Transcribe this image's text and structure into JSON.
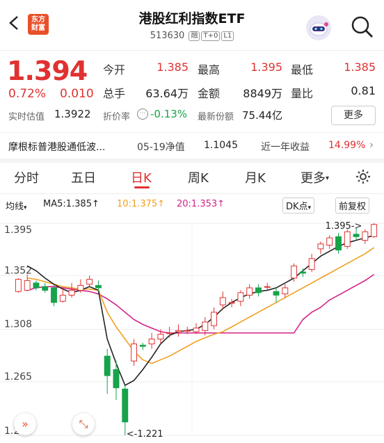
{
  "header": {
    "title": "港股红利指数ETF",
    "code": "513630",
    "tags": [
      "融",
      "T+0",
      "L1"
    ],
    "logo": "东方财富"
  },
  "quote": {
    "price": "1.394",
    "change_pct": "0.72%",
    "change": "0.010",
    "open_label": "今开",
    "open": "1.385",
    "high_label": "最高",
    "high": "1.395",
    "low_label": "最低",
    "low": "1.385",
    "vol_label": "总手",
    "vol": "63.64万",
    "amount_label": "金额",
    "amount": "8849万",
    "ratio_label": "量比",
    "ratio": "0.81",
    "iopv_label": "实时估值",
    "iopv": "1.3922",
    "premium_label": "折价率",
    "premium": "-0.13%",
    "shares_label": "最新份额",
    "shares": "75.44亿",
    "more": "更多"
  },
  "info": {
    "index_name": "摩根标普港股通低波...",
    "nav_date": "05-19净值",
    "nav": "1.1045",
    "year_label": "近一年收益",
    "year_ret": "14.99%"
  },
  "tabs": [
    "分时",
    "五日",
    "日K",
    "周K",
    "月K",
    "更多"
  ],
  "toolbar": {
    "ma_btn": "均线",
    "ma5": "MA5:1.385",
    "ma10": "10:1.375",
    "ma20": "20:1.353",
    "dk": "DK点",
    "adjust": "前复权"
  },
  "colors": {
    "up": "#e03131",
    "down": "#17a34a",
    "ma5": "#222222",
    "ma10": "#f0a020",
    "ma20": "#d2238a"
  },
  "chart_data": {
    "type": "candlestick",
    "ylim": [
      1.221,
      1.395
    ],
    "y_ticks": [
      "1.395",
      "1.352",
      "1.308",
      "1.265",
      "1.221"
    ],
    "max_label": "1.395->",
    "min_label": "<-1.221",
    "candles": [
      [
        1.339,
        1.349,
        1.35,
        1.338
      ],
      [
        1.34,
        1.348,
        1.353,
        1.339
      ],
      [
        1.346,
        1.342,
        1.348,
        1.34
      ],
      [
        1.343,
        1.34,
        1.346,
        1.338
      ],
      [
        1.342,
        1.33,
        1.345,
        1.327
      ],
      [
        1.331,
        1.336,
        1.342,
        1.33
      ],
      [
        1.336,
        1.34,
        1.346,
        1.334
      ],
      [
        1.34,
        1.344,
        1.349,
        1.338
      ],
      [
        1.345,
        1.349,
        1.352,
        1.343
      ],
      [
        1.344,
        1.342,
        1.348,
        1.339
      ],
      [
        1.286,
        1.27,
        1.292,
        1.255
      ],
      [
        1.275,
        1.26,
        1.282,
        1.25
      ],
      [
        1.259,
        1.232,
        1.262,
        1.221
      ],
      [
        1.282,
        1.296,
        1.3,
        1.278
      ],
      [
        1.295,
        1.294,
        1.297,
        1.291
      ],
      [
        1.296,
        1.3,
        1.305,
        1.292
      ],
      [
        1.3,
        1.304,
        1.308,
        1.296
      ],
      [
        1.305,
        1.305,
        1.31,
        1.301
      ],
      [
        1.306,
        1.307,
        1.312,
        1.302
      ],
      [
        1.307,
        1.307,
        1.31,
        1.304
      ],
      [
        1.306,
        1.309,
        1.313,
        1.304
      ],
      [
        1.307,
        1.314,
        1.318,
        1.303
      ],
      [
        1.311,
        1.322,
        1.326,
        1.308
      ],
      [
        1.328,
        1.334,
        1.339,
        1.324
      ],
      [
        1.33,
        1.33,
        1.333,
        1.326
      ],
      [
        1.331,
        1.338,
        1.34,
        1.327
      ],
      [
        1.336,
        1.342,
        1.345,
        1.333
      ],
      [
        1.342,
        1.338,
        1.345,
        1.335
      ],
      [
        1.343,
        1.343,
        1.346,
        1.34
      ],
      [
        1.339,
        1.336,
        1.342,
        1.33
      ],
      [
        1.337,
        1.342,
        1.345,
        1.334
      ],
      [
        1.35,
        1.36,
        1.362,
        1.347
      ],
      [
        1.355,
        1.354,
        1.358,
        1.351
      ],
      [
        1.357,
        1.366,
        1.37,
        1.355
      ],
      [
        1.374,
        1.378,
        1.38,
        1.37
      ],
      [
        1.377,
        1.383,
        1.385,
        1.374
      ],
      [
        1.384,
        1.373,
        1.387,
        1.37
      ],
      [
        1.376,
        1.388,
        1.39,
        1.374
      ],
      [
        1.386,
        1.384,
        1.391,
        1.381
      ],
      [
        1.381,
        1.388,
        1.39,
        1.378
      ],
      [
        1.384,
        1.394,
        1.395,
        1.383
      ]
    ],
    "ma5": [
      1.36,
      1.356,
      1.35,
      1.345,
      1.341,
      1.338,
      1.34,
      1.343,
      1.34,
      1.3,
      1.28,
      1.262,
      1.266,
      1.275,
      1.285,
      1.296,
      1.303,
      1.306,
      1.307,
      1.308,
      1.312,
      1.318,
      1.325,
      1.33,
      1.334,
      1.337,
      1.339,
      1.34,
      1.342,
      1.346,
      1.35,
      1.356,
      1.362,
      1.368,
      1.372,
      1.376,
      1.379,
      1.381,
      1.383,
      1.385
    ],
    "ma10": [
      1.35,
      1.349,
      1.347,
      1.345,
      1.343,
      1.342,
      1.341,
      1.341,
      1.34,
      1.322,
      1.31,
      1.3,
      1.29,
      1.283,
      1.28,
      1.283,
      1.286,
      1.29,
      1.294,
      1.298,
      1.301,
      1.304,
      1.306,
      1.31,
      1.314,
      1.318,
      1.322,
      1.326,
      1.33,
      1.334,
      1.338,
      1.342,
      1.346,
      1.35,
      1.354,
      1.358,
      1.362,
      1.366,
      1.37,
      1.375
    ],
    "ma20": [
      1.34,
      1.342,
      1.343,
      1.343,
      1.342,
      1.341,
      1.34,
      1.339,
      1.337,
      1.333,
      1.328,
      1.322,
      1.316,
      1.312,
      1.309,
      1.306,
      1.305,
      1.305,
      1.305,
      1.305,
      1.305,
      1.305,
      1.305,
      1.305,
      1.305,
      1.305,
      1.305,
      1.305,
      1.305,
      1.305,
      1.305,
      1.316,
      1.322,
      1.326,
      1.332,
      1.336,
      1.34,
      1.344,
      1.348,
      1.353
    ]
  }
}
